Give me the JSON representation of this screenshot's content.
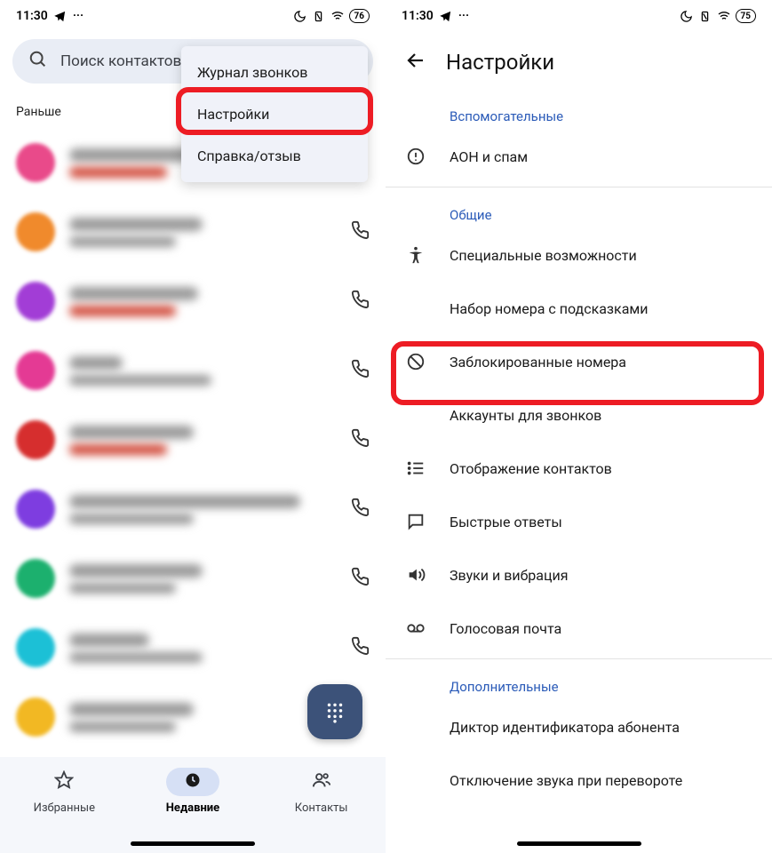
{
  "status": {
    "time": "11:30",
    "battery_left": "76",
    "battery_right": "75"
  },
  "left_screen": {
    "search_placeholder": "Поиск контактов",
    "section": "Раньше",
    "menu": {
      "item1": "Журнал звонков",
      "item2": "Настройки",
      "item3": "Справка/отзыв"
    },
    "nav": {
      "favorites": "Избранные",
      "recent": "Недавние",
      "contacts": "Контакты"
    }
  },
  "right_screen": {
    "title": "Настройки",
    "sections": {
      "assistive": "Вспомогательные",
      "general": "Общие",
      "additional": "Дополнительные"
    },
    "items": {
      "caller_id_spam": "АОН и спам",
      "accessibility": "Специальные возможности",
      "assisted_dialing": "Набор номера с подсказками",
      "blocked": "Заблокированные номера",
      "calling_accounts": "Аккаунты для звонков",
      "display_contacts": "Отображение контактов",
      "quick_responses": "Быстрые ответы",
      "sounds": "Звуки и вибрация",
      "voicemail": "Голосовая почта",
      "caller_announce": "Диктор идентификатора абонента",
      "flip_silence": "Отключение звука при перевороте"
    }
  }
}
